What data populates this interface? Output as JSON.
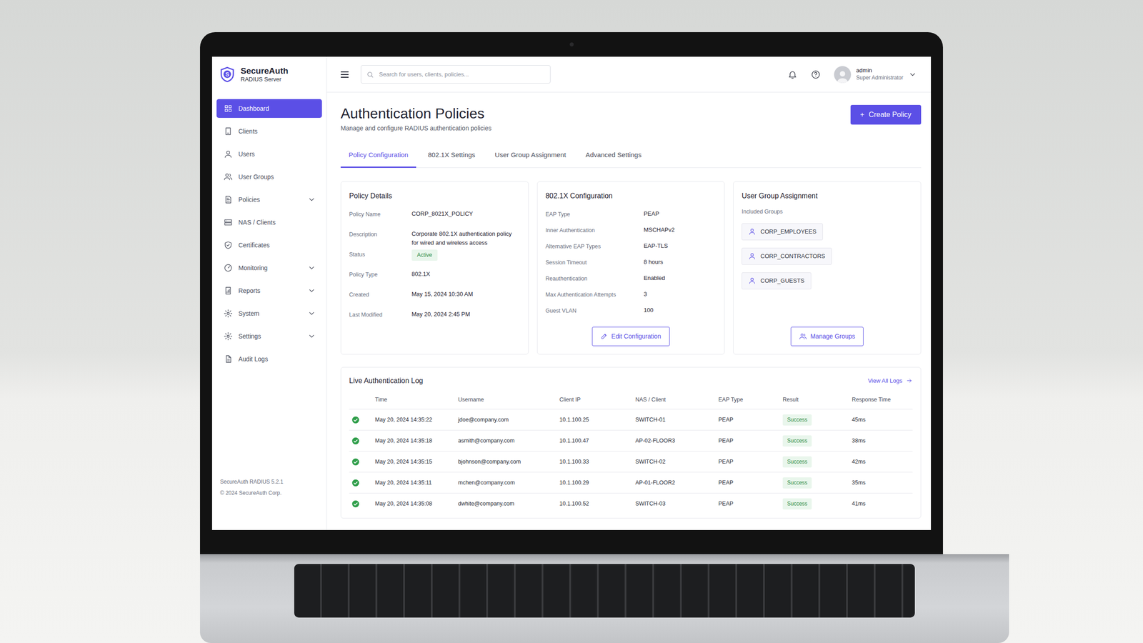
{
  "app": {
    "logo": "S",
    "name": "SecureAuth",
    "subtitle": "RADIUS Server"
  },
  "search": {
    "placeholder": "Search for users, clients, policies..."
  },
  "user": {
    "name": "admin",
    "role": "Super Administrator"
  },
  "sidebar": {
    "items": [
      {
        "label": "Dashboard",
        "selected": true,
        "kind": "link"
      },
      {
        "label": "Clients",
        "selected": false,
        "kind": "link"
      },
      {
        "label": "Users",
        "selected": false,
        "kind": "link"
      },
      {
        "label": "User Groups",
        "selected": false,
        "kind": "link"
      },
      {
        "label": "Policies",
        "selected": false,
        "kind": "group"
      },
      {
        "label": "NAS / Clients",
        "selected": false,
        "kind": "link"
      },
      {
        "label": "Certificates",
        "selected": false,
        "kind": "link"
      },
      {
        "label": "Monitoring",
        "selected": false,
        "kind": "group"
      },
      {
        "label": "Reports",
        "selected": false,
        "kind": "group"
      },
      {
        "label": "System",
        "selected": false,
        "kind": "group"
      },
      {
        "label": "Settings",
        "selected": false,
        "kind": "group"
      },
      {
        "label": "Audit Logs",
        "selected": false,
        "kind": "link"
      }
    ],
    "footer": [
      "SecureAuth RADIUS 5.2.1",
      "© 2024 SecureAuth Corp."
    ]
  },
  "page": {
    "title": "Authentication Policies",
    "subtitle": "Manage and configure RADIUS authentication policies",
    "create_button": {
      "icon": "+",
      "label": "Create Policy"
    }
  },
  "tabs": [
    {
      "label": "Policy Configuration",
      "selected": true
    },
    {
      "label": "802.1X Settings",
      "selected": false
    },
    {
      "label": "User Group Assignment",
      "selected": false
    },
    {
      "label": "Advanced Settings",
      "selected": false
    }
  ],
  "policy_details": {
    "title": "Policy Details",
    "fields": [
      {
        "label": "Policy Name",
        "value": "CORP_8021X_POLICY",
        "kind": "text"
      },
      {
        "label": "Description",
        "value": "Corporate 802.1X authentication policy for wired and wireless access",
        "kind": "text"
      },
      {
        "label": "Status",
        "value": "Active",
        "kind": "badge"
      },
      {
        "label": "Policy Type",
        "value": "802.1X",
        "kind": "text"
      },
      {
        "label": "Created",
        "value": "May 15, 2024 10:30 AM",
        "kind": "text"
      },
      {
        "label": "Last Modified",
        "value": "May 20, 2024 2:45 PM",
        "kind": "text"
      }
    ]
  },
  "config": {
    "title": "802.1X Configuration",
    "fields": [
      {
        "label": "EAP Type",
        "value": "PEAP"
      },
      {
        "label": "Inner Authentication",
        "value": "MSCHAPv2"
      },
      {
        "label": "Alternative EAP Types",
        "value": "EAP-TLS"
      },
      {
        "label": "Session Timeout",
        "value": "8 hours"
      },
      {
        "label": "Reauthentication",
        "value": "Enabled"
      },
      {
        "label": "Max Authentication Attempts",
        "value": "3"
      },
      {
        "label": "Guest VLAN",
        "value": "100"
      }
    ],
    "button": "Edit Configuration"
  },
  "groups": {
    "title": "User Group Assignment",
    "label": "Included Groups",
    "items": [
      "CORP_EMPLOYEES",
      "CORP_CONTRACTORS",
      "CORP_GUESTS"
    ],
    "button": "Manage Groups"
  },
  "log": {
    "title": "Live Authentication Log",
    "link": "View All Logs",
    "columns": [
      "Time",
      "Username",
      "Client IP",
      "NAS / Client",
      "EAP Type",
      "Result",
      "Response Time"
    ],
    "rows": [
      {
        "ok": true,
        "time": "May 20, 2024 14:35:22",
        "username": "jdoe@company.com",
        "ip": "10.1.100.25",
        "nas": "SWITCH-01",
        "eap": "PEAP",
        "result": "Success",
        "response_time": "45ms"
      },
      {
        "ok": true,
        "time": "May 20, 2024 14:35:18",
        "username": "asmith@company.com",
        "ip": "10.1.100.47",
        "nas": "AP-02-FLOOR3",
        "eap": "PEAP",
        "result": "Success",
        "response_time": "38ms"
      },
      {
        "ok": true,
        "time": "May 20, 2024 14:35:15",
        "username": "bjohnson@company.com",
        "ip": "10.1.100.33",
        "nas": "SWITCH-02",
        "eap": "PEAP",
        "result": "Success",
        "response_time": "42ms"
      },
      {
        "ok": true,
        "time": "May 20, 2024 14:35:11",
        "username": "mchen@company.com",
        "ip": "10.1.100.29",
        "nas": "AP-01-FLOOR2",
        "eap": "PEAP",
        "result": "Success",
        "response_time": "35ms"
      },
      {
        "ok": true,
        "time": "May 20, 2024 14:35:08",
        "username": "dwhite@company.com",
        "ip": "10.1.100.52",
        "nas": "SWITCH-03",
        "eap": "PEAP",
        "result": "Success",
        "response_time": "41ms"
      }
    ]
  }
}
